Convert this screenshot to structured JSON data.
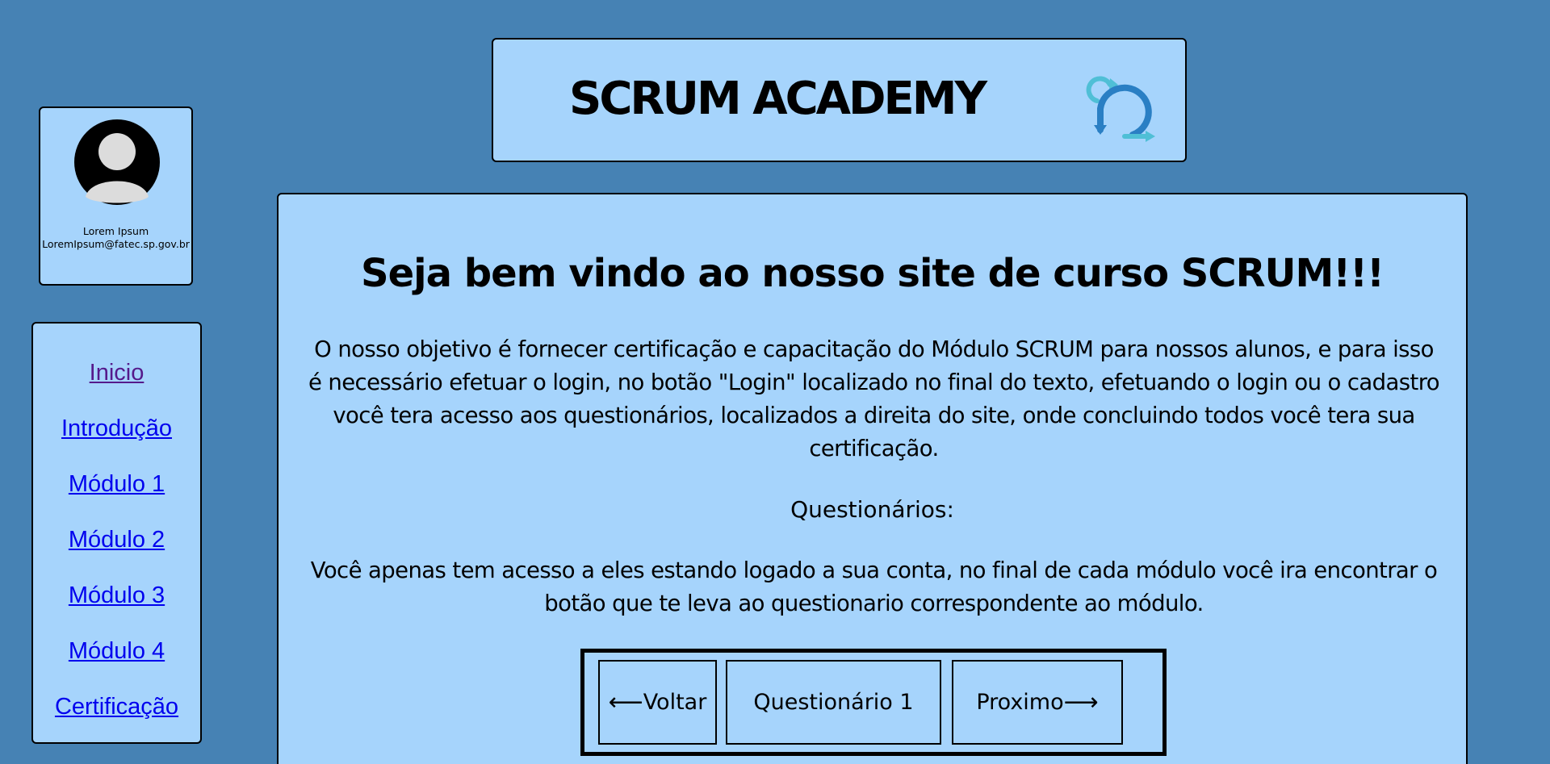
{
  "profile": {
    "name": "Lorem Ipsum",
    "email": "LoremIpsum@fatec.sp.gov.br"
  },
  "nav": {
    "items": [
      {
        "label": "Inicio",
        "visited": true
      },
      {
        "label": "Introdução"
      },
      {
        "label": "Módulo 1"
      },
      {
        "label": "Módulo 2"
      },
      {
        "label": "Módulo 3"
      },
      {
        "label": "Módulo 4"
      },
      {
        "label": "Certificação"
      }
    ]
  },
  "header": {
    "title": "SCRUM ACADEMY",
    "logo_icon": "scrum-cycle-icon"
  },
  "main": {
    "welcome_title": "Seja bem vindo ao nosso site de curso SCRUM!!!",
    "intro_text": "O nosso objetivo é fornecer certificação e capacitação do Módulo SCRUM para nossos alunos, e para isso é necessário efetuar o login, no botão \"Login\" localizado no final do texto, efetuando o login ou o cadastro você tera acesso aos questionários, localizados a direita do site, onde concluindo todos você tera sua certificação.",
    "quiz_heading": "Questionários:",
    "quiz_text": "Você apenas tem acesso a eles estando logado a sua conta, no final de cada módulo você ira encontrar o botão que te leva ao questionario correspondente ao módulo.",
    "buttons": {
      "back_arrow": "⟵",
      "back": "Voltar",
      "quiz": "Questionário 1",
      "next": "Proximo",
      "next_arrow": "⟶"
    }
  },
  "colors": {
    "page_background": "#4682b4",
    "card_background": "#a6d4fc",
    "link": "#0000ee",
    "link_visited": "#551a8b",
    "logo_dark": "#2a7fc4",
    "logo_light": "#4fbfd6"
  }
}
